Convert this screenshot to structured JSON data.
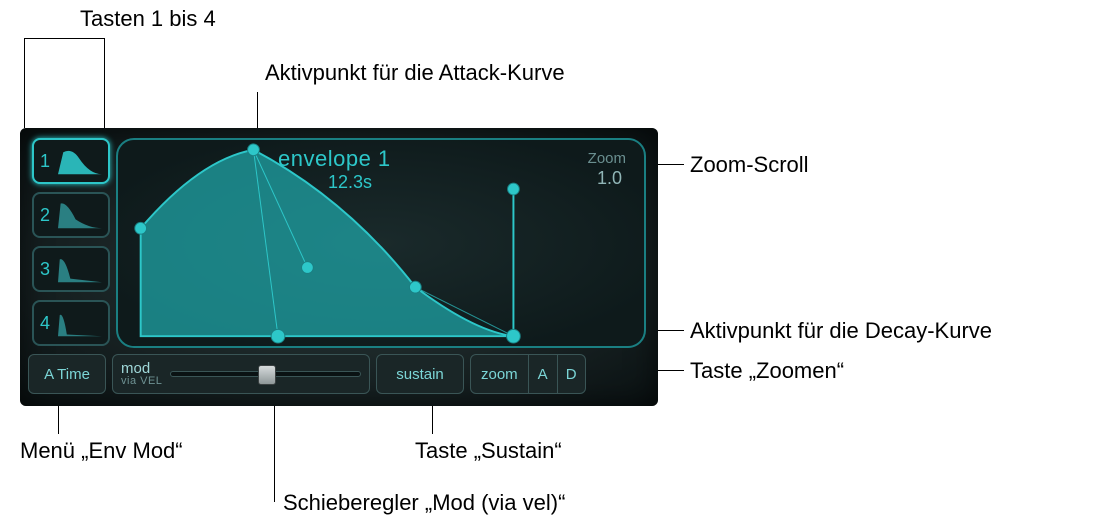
{
  "callouts": {
    "presets": "Tasten 1 bis 4",
    "attack_point": "Aktivpunkt für die Attack-Kurve",
    "zoom_scroll": "Zoom-Scroll",
    "decay_point": "Aktivpunkt für die Decay-Kurve",
    "zoom_button": "Taste „Zoomen“",
    "env_mod_menu": "Menü „Env Mod“",
    "sustain_button": "Taste „Sustain“",
    "mod_slider": "Schieberegler „Mod (via vel)“"
  },
  "envelope": {
    "name": "envelope 1",
    "time": "12.3s",
    "zoom_label": "Zoom",
    "zoom_value": "1.0"
  },
  "presets": [
    {
      "num": "1",
      "active": true
    },
    {
      "num": "2",
      "active": false
    },
    {
      "num": "3",
      "active": false
    },
    {
      "num": "4",
      "active": false
    }
  ],
  "controls": {
    "env_mod_menu": "A Time",
    "mod_label": "mod",
    "mod_sublabel": "via VEL",
    "sustain": "sustain",
    "zoom": "zoom",
    "zoom_a": "A",
    "zoom_d": "D"
  }
}
